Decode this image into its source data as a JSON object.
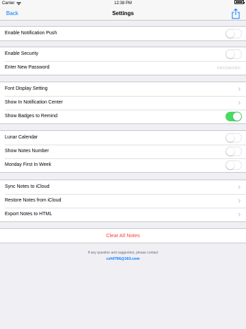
{
  "status": {
    "carrier": "Carrier",
    "time": "12:38 PM"
  },
  "nav": {
    "back_label": "Back",
    "title": "Settings"
  },
  "groups": {
    "push": {
      "notification_push_label": "Enable Notification Push",
      "notification_push_on": false
    },
    "security": {
      "enable_security_label": "Enable Security",
      "enable_security_on": false,
      "password_label": "Enter New Password",
      "password_placeholder": "PASSWORD"
    },
    "display": {
      "font_display_label": "Font Display Setting",
      "notification_center_label": "Show In Notification Center",
      "badges_label": "Show Badges to Remind",
      "badges_on": true
    },
    "calendar": {
      "lunar_label": "Lunar Calendar",
      "lunar_on": false,
      "notes_number_label": "Show Notes Number",
      "notes_number_on": false,
      "monday_label": "Monday First In Week",
      "monday_on": false
    },
    "icloud": {
      "sync_label": "Sync Notes to iCloud",
      "restore_label": "Restore Notes from iCloud",
      "export_label": "Export Notes to HTML"
    },
    "clear": {
      "label": "Clear All Notes"
    }
  },
  "footer": {
    "text": "If any question and suggestion, please contact",
    "email": "czh0766@163.com"
  },
  "colors": {
    "accent": "#007aff",
    "toggle_on": "#4cd964",
    "danger": "#ff3b30",
    "background": "#efeff4"
  },
  "icons": {
    "share": "share-icon",
    "chevron": "chevron-right-icon",
    "wifi": "wifi-icon",
    "battery": "battery-icon"
  }
}
